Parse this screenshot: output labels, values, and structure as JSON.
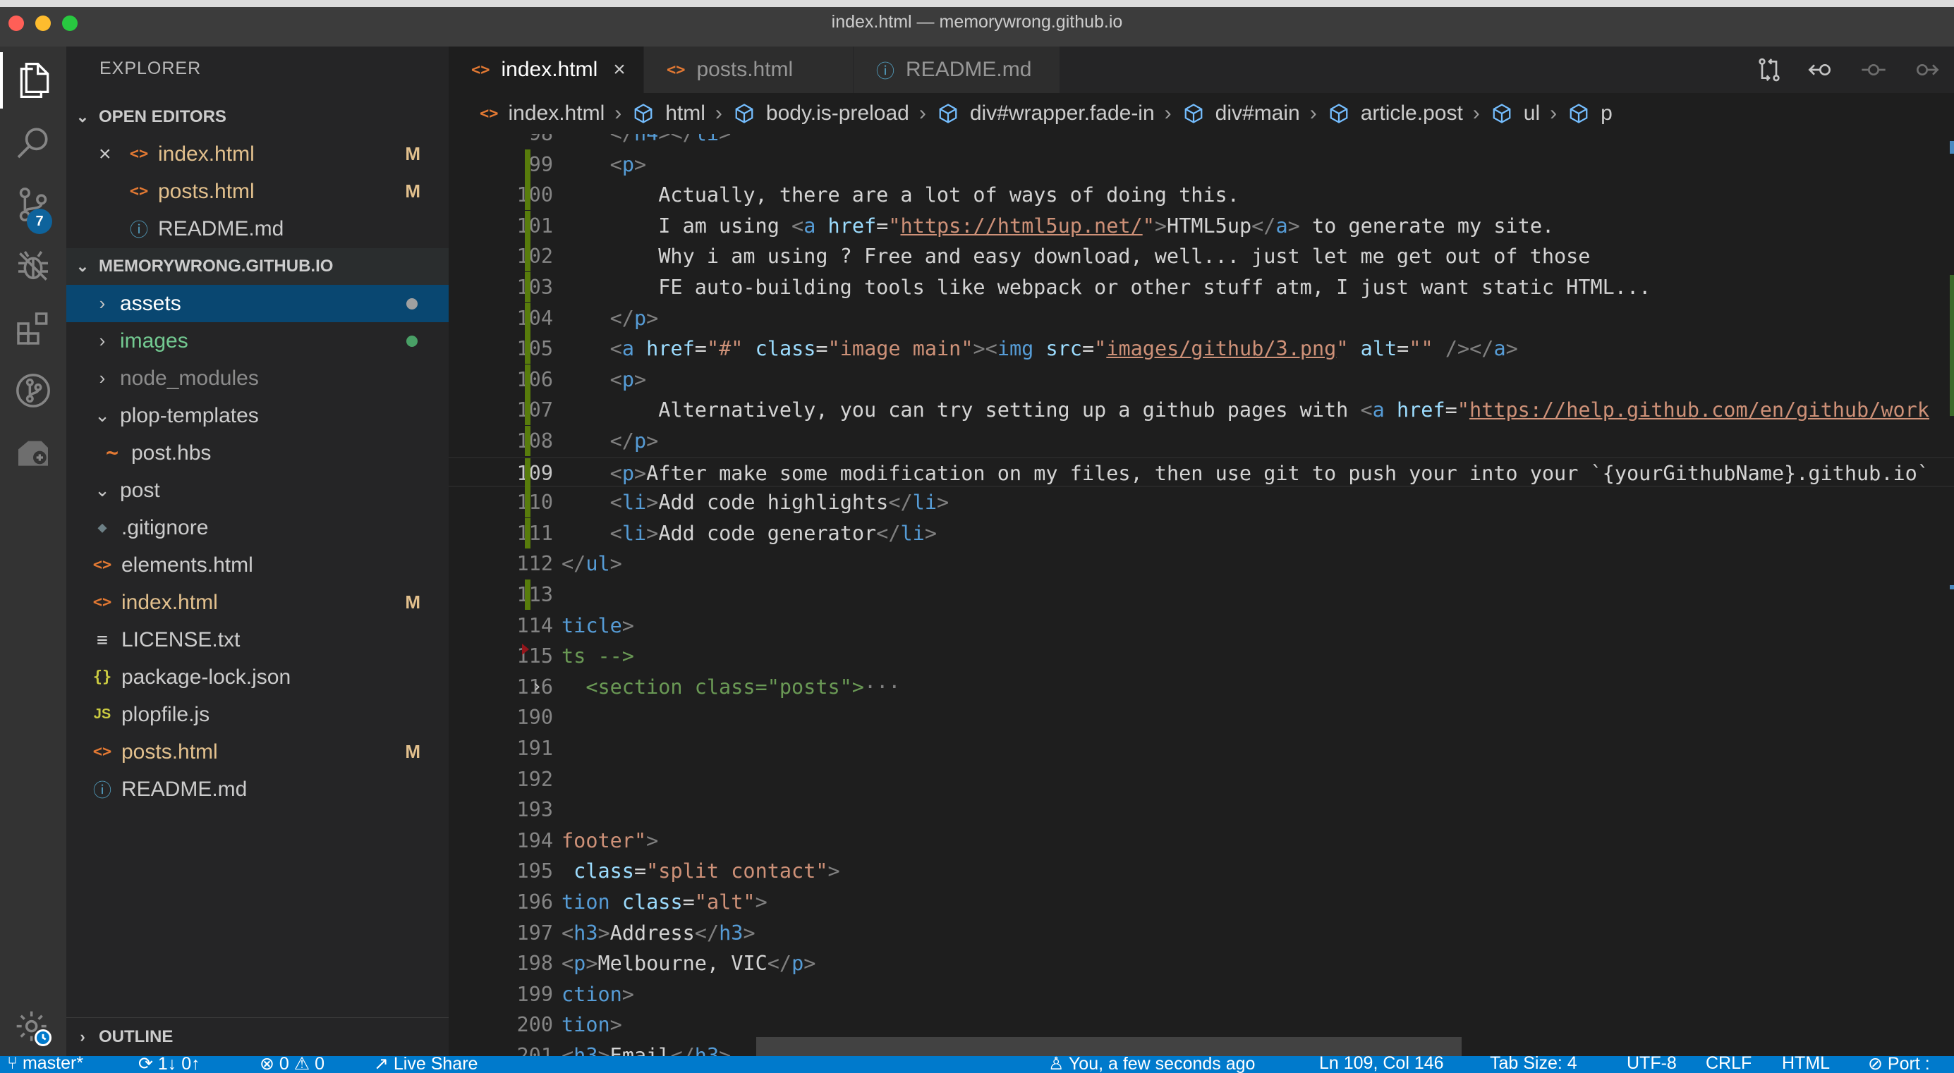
{
  "window": {
    "title": "index.html — memorywrong.github.io",
    "traffic_lights": [
      "#ff5f57",
      "#febc2e",
      "#28c840"
    ]
  },
  "activity_bar": {
    "items": [
      {
        "name": "files-icon",
        "active": true
      },
      {
        "name": "search-icon"
      },
      {
        "name": "source-control-icon",
        "badge": "7"
      },
      {
        "name": "debug-icon"
      },
      {
        "name": "extensions-icon"
      },
      {
        "name": "git-graph-icon"
      },
      {
        "name": "remote-explorer-icon"
      }
    ],
    "bottom": {
      "name": "manage-gear-icon"
    }
  },
  "sidebar": {
    "title": "EXPLORER",
    "open_editors": {
      "label": "OPEN EDITORS",
      "items": [
        {
          "label": "index.html",
          "icon": "<>",
          "status": "M",
          "close": "×"
        },
        {
          "label": "posts.html",
          "icon": "<>",
          "status": "M"
        },
        {
          "label": "README.md",
          "icon": "ⓘ",
          "status": ""
        }
      ]
    },
    "workspace": {
      "label": "MEMORYWRONG.GITHUB.IO",
      "items": [
        {
          "label": "assets",
          "type": "folder",
          "state": "collapsed",
          "selected": true,
          "decoration": "dot"
        },
        {
          "label": "images",
          "type": "folder",
          "state": "collapsed",
          "decoration": "dot"
        },
        {
          "label": "node_modules",
          "type": "folder",
          "state": "collapsed"
        },
        {
          "label": "plop-templates",
          "type": "folder",
          "state": "expanded"
        },
        {
          "label": "post.hbs",
          "type": "file",
          "icon": "~",
          "indent": 1
        },
        {
          "label": "post",
          "type": "folder",
          "state": "expanded"
        },
        {
          "label": ".gitignore",
          "type": "file",
          "icon": "◆"
        },
        {
          "label": "elements.html",
          "type": "file",
          "icon": "<>"
        },
        {
          "label": "index.html",
          "type": "file",
          "icon": "<>",
          "status": "M"
        },
        {
          "label": "LICENSE.txt",
          "type": "file",
          "icon": "≡"
        },
        {
          "label": "package-lock.json",
          "type": "file",
          "icon": "{}"
        },
        {
          "label": "plopfile.js",
          "type": "file",
          "icon": "JS"
        },
        {
          "label": "posts.html",
          "type": "file",
          "icon": "<>",
          "status": "M"
        },
        {
          "label": "README.md",
          "type": "file",
          "icon": "ⓘ"
        }
      ]
    },
    "outline": {
      "label": "OUTLINE"
    }
  },
  "tabs": [
    {
      "label": "index.html",
      "icon": "<>",
      "active": true,
      "close": "×"
    },
    {
      "label": "posts.html",
      "icon": "<>"
    },
    {
      "label": "README.md",
      "icon": "ⓘ"
    }
  ],
  "editor_actions": [
    "compare-changes-icon",
    "go-back-icon",
    "dot-circle-icon",
    "go-forward-icon"
  ],
  "breadcrumb": [
    "index.html",
    "html",
    "body.is-preload",
    "div#wrapper.fade-in",
    "div#main",
    "article.post",
    "ul",
    "p"
  ],
  "code": {
    "lines": [
      {
        "n": "98",
        "partial": true,
        "tokens": [
          [
            "t-brk",
            "    </"
          ],
          [
            "t-tag",
            "h4"
          ],
          [
            "t-brk",
            "></"
          ],
          [
            "t-tag",
            "li"
          ],
          [
            "t-brk",
            ">"
          ]
        ]
      },
      {
        "n": "99",
        "mark": "green",
        "tokens": [
          [
            "t-txt",
            "    "
          ],
          [
            "t-brk",
            "<"
          ],
          [
            "t-tag",
            "p"
          ],
          [
            "t-brk",
            ">"
          ]
        ]
      },
      {
        "n": "100",
        "mark": "green",
        "tokens": [
          [
            "t-txt",
            "        Actually, there are a lot of ways of doing this."
          ]
        ]
      },
      {
        "n": "101",
        "mark": "green",
        "tokens": [
          [
            "t-txt",
            "        I am using "
          ],
          [
            "t-brk",
            "<"
          ],
          [
            "t-tag",
            "a"
          ],
          [
            "t-txt",
            " "
          ],
          [
            "t-attr",
            "href"
          ],
          [
            "t-txt",
            "="
          ],
          [
            "t-str",
            "\""
          ],
          [
            "t-url",
            "https://html5up.net/"
          ],
          [
            "t-str",
            "\""
          ],
          [
            "t-brk",
            ">"
          ],
          [
            "t-txt",
            "HTML5up"
          ],
          [
            "t-brk",
            "</"
          ],
          [
            "t-tag",
            "a"
          ],
          [
            "t-brk",
            ">"
          ],
          [
            "t-txt",
            " to generate my site."
          ]
        ]
      },
      {
        "n": "102",
        "mark": "green",
        "tokens": [
          [
            "t-txt",
            "        Why i am using ? Free and easy download, well... just let me get out of those"
          ]
        ]
      },
      {
        "n": "103",
        "mark": "green",
        "tokens": [
          [
            "t-txt",
            "        FE auto-building tools like webpack or other stuff atm, I just want static HTML..."
          ]
        ]
      },
      {
        "n": "104",
        "mark": "green",
        "tokens": [
          [
            "t-txt",
            "    "
          ],
          [
            "t-brk",
            "</"
          ],
          [
            "t-tag",
            "p"
          ],
          [
            "t-brk",
            ">"
          ]
        ]
      },
      {
        "n": "105",
        "mark": "green",
        "tokens": [
          [
            "t-txt",
            "    "
          ],
          [
            "t-brk",
            "<"
          ],
          [
            "t-tag",
            "a"
          ],
          [
            "t-txt",
            " "
          ],
          [
            "t-attr",
            "href"
          ],
          [
            "t-txt",
            "="
          ],
          [
            "t-str",
            "\"#\""
          ],
          [
            "t-txt",
            " "
          ],
          [
            "t-attr",
            "class"
          ],
          [
            "t-txt",
            "="
          ],
          [
            "t-str",
            "\"image main\""
          ],
          [
            "t-brk",
            "><"
          ],
          [
            "t-tag",
            "img"
          ],
          [
            "t-txt",
            " "
          ],
          [
            "t-attr",
            "src"
          ],
          [
            "t-txt",
            "="
          ],
          [
            "t-str",
            "\""
          ],
          [
            "t-url",
            "images/github/3.png"
          ],
          [
            "t-str",
            "\""
          ],
          [
            "t-txt",
            " "
          ],
          [
            "t-attr",
            "alt"
          ],
          [
            "t-txt",
            "="
          ],
          [
            "t-str",
            "\"\""
          ],
          [
            "t-txt",
            " "
          ],
          [
            "t-brk",
            "/></"
          ],
          [
            "t-tag",
            "a"
          ],
          [
            "t-brk",
            ">"
          ]
        ]
      },
      {
        "n": "106",
        "mark": "green",
        "tokens": [
          [
            "t-txt",
            "    "
          ],
          [
            "t-brk",
            "<"
          ],
          [
            "t-tag",
            "p"
          ],
          [
            "t-brk",
            ">"
          ]
        ]
      },
      {
        "n": "107",
        "mark": "green",
        "tokens": [
          [
            "t-txt",
            "        Alternatively, you can try setting up a github pages with "
          ],
          [
            "t-brk",
            "<"
          ],
          [
            "t-tag",
            "a"
          ],
          [
            "t-txt",
            " "
          ],
          [
            "t-attr",
            "href"
          ],
          [
            "t-txt",
            "="
          ],
          [
            "t-str",
            "\""
          ],
          [
            "t-url",
            "https://help.github.com/en/github/work"
          ]
        ]
      },
      {
        "n": "108",
        "mark": "green",
        "tokens": [
          [
            "t-txt",
            "    "
          ],
          [
            "t-brk",
            "</"
          ],
          [
            "t-tag",
            "p"
          ],
          [
            "t-brk",
            ">"
          ]
        ]
      },
      {
        "n": "109",
        "mark": "green",
        "current": true,
        "tokens": [
          [
            "t-txt",
            "    "
          ],
          [
            "t-brk",
            "<"
          ],
          [
            "t-tag",
            "p"
          ],
          [
            "t-brk",
            ">"
          ],
          [
            "t-txt",
            "After make some modification on my files, then use git to push your into your `{yourGithubName}.github.io`"
          ]
        ]
      },
      {
        "n": "110",
        "mark": "green",
        "tokens": [
          [
            "t-txt",
            "    "
          ],
          [
            "t-brk",
            "<"
          ],
          [
            "t-tag",
            "li"
          ],
          [
            "t-brk",
            ">"
          ],
          [
            "t-txt",
            "Add code highlights"
          ],
          [
            "t-brk",
            "</"
          ],
          [
            "t-tag",
            "li"
          ],
          [
            "t-brk",
            ">"
          ]
        ]
      },
      {
        "n": "111",
        "mark": "green",
        "tokens": [
          [
            "t-txt",
            "    "
          ],
          [
            "t-brk",
            "<"
          ],
          [
            "t-tag",
            "li"
          ],
          [
            "t-brk",
            ">"
          ],
          [
            "t-txt",
            "Add code generator"
          ],
          [
            "t-brk",
            "</"
          ],
          [
            "t-tag",
            "li"
          ],
          [
            "t-brk",
            ">"
          ]
        ]
      },
      {
        "n": "112",
        "tokens": [
          [
            "t-brk",
            "</"
          ],
          [
            "t-tag",
            "ul"
          ],
          [
            "t-brk",
            ">"
          ]
        ]
      },
      {
        "n": "113",
        "mark": "green",
        "tokens": []
      },
      {
        "n": "114",
        "tokens": [
          [
            "t-tag",
            "ticle"
          ],
          [
            "t-brk",
            ">"
          ]
        ]
      },
      {
        "n": "115",
        "mark": "red",
        "tokens": [
          [
            "t-cmt",
            "ts -->"
          ]
        ]
      },
      {
        "n": "116",
        "fold": true,
        "tokens": [
          [
            "t-cmt",
            "  <section class=\"posts\">"
          ],
          [
            "t-brk",
            "···"
          ]
        ]
      },
      {
        "n": "190",
        "tokens": []
      },
      {
        "n": "191",
        "tokens": []
      },
      {
        "n": "192",
        "tokens": []
      },
      {
        "n": "193",
        "tokens": []
      },
      {
        "n": "194",
        "tokens": [
          [
            "t-str",
            "footer\""
          ],
          [
            "t-brk",
            ">"
          ]
        ]
      },
      {
        "n": "195",
        "tokens": [
          [
            "t-txt",
            " "
          ],
          [
            "t-attr",
            "class"
          ],
          [
            "t-txt",
            "="
          ],
          [
            "t-str",
            "\"split contact\""
          ],
          [
            "t-brk",
            ">"
          ]
        ]
      },
      {
        "n": "196",
        "tokens": [
          [
            "t-tag",
            "tion"
          ],
          [
            "t-txt",
            " "
          ],
          [
            "t-attr",
            "class"
          ],
          [
            "t-txt",
            "="
          ],
          [
            "t-str",
            "\"alt\""
          ],
          [
            "t-brk",
            ">"
          ]
        ]
      },
      {
        "n": "197",
        "tokens": [
          [
            "t-brk",
            "<"
          ],
          [
            "t-tag",
            "h3"
          ],
          [
            "t-brk",
            ">"
          ],
          [
            "t-txt",
            "Address"
          ],
          [
            "t-brk",
            "</"
          ],
          [
            "t-tag",
            "h3"
          ],
          [
            "t-brk",
            ">"
          ]
        ]
      },
      {
        "n": "198",
        "tokens": [
          [
            "t-brk",
            "<"
          ],
          [
            "t-tag",
            "p"
          ],
          [
            "t-brk",
            ">"
          ],
          [
            "t-txt",
            "Melbourne, VIC"
          ],
          [
            "t-brk",
            "</"
          ],
          [
            "t-tag",
            "p"
          ],
          [
            "t-brk",
            ">"
          ]
        ]
      },
      {
        "n": "199",
        "tokens": [
          [
            "t-tag",
            "ction"
          ],
          [
            "t-brk",
            ">"
          ]
        ]
      },
      {
        "n": "200",
        "tokens": [
          [
            "t-tag",
            "tion"
          ],
          [
            "t-brk",
            ">"
          ]
        ]
      },
      {
        "n": "201",
        "tokens": [
          [
            "t-brk",
            "<"
          ],
          [
            "t-tag",
            "h3"
          ],
          [
            "t-brk",
            ">"
          ],
          [
            "t-txt",
            "Email"
          ],
          [
            "t-brk",
            "</"
          ],
          [
            "t-tag",
            "h3"
          ],
          [
            "t-brk",
            ">"
          ]
        ]
      }
    ]
  },
  "status_bar": {
    "branch": "master*",
    "sync": "1↓ 0↑",
    "problems": "⊗ 0 ⚠ 0",
    "live_share": "Live Share",
    "blame": "You, a few seconds ago",
    "cursor": "Ln 109, Col 146",
    "tab_size": "Tab Size: 4",
    "encoding": "UTF-8",
    "eol": "CRLF",
    "language": "HTML",
    "port": "Port :"
  },
  "colors": {
    "accent": "#007acc",
    "selection": "#094771",
    "modified": "#e2c08d",
    "untracked": "#73c991",
    "html_icon": "#e37933",
    "info_icon": "#519aba",
    "json_icon": "#cbcb41",
    "gutter_added": "#587c0c"
  }
}
